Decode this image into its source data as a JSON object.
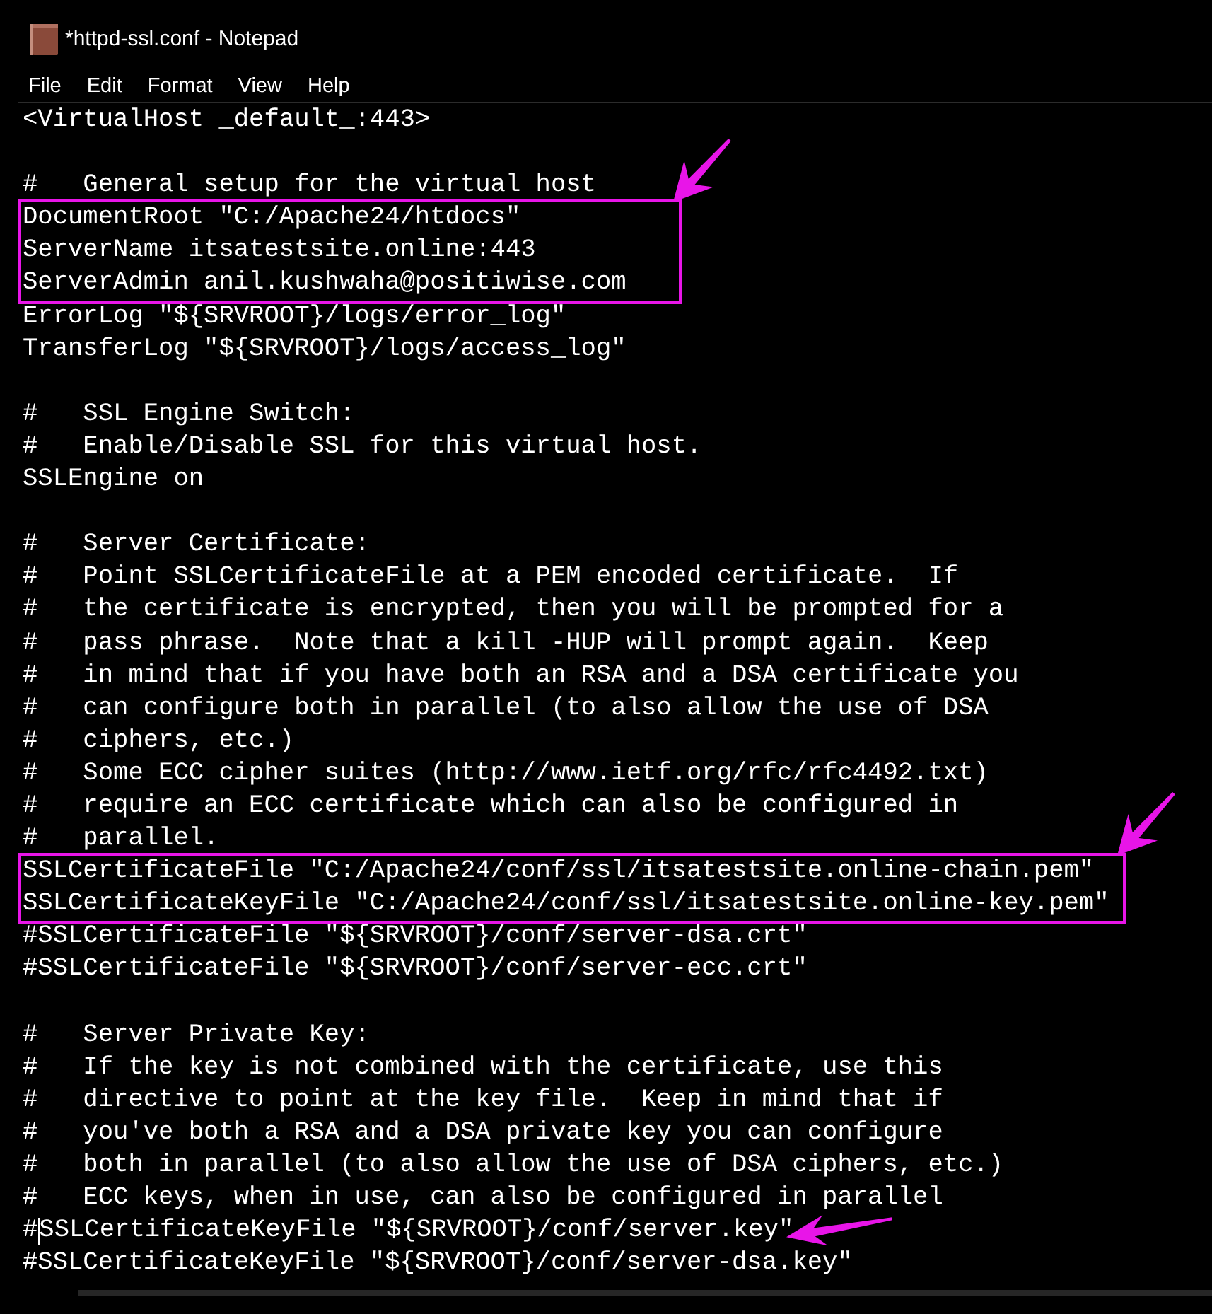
{
  "window": {
    "title": "*httpd-ssl.conf - Notepad"
  },
  "menu": [
    "File",
    "Edit",
    "Format",
    "View",
    "Help"
  ],
  "editor": {
    "blocks": [
      {
        "items": [
          {
            "kind": "line",
            "text": "<VirtualHost _default_:443>"
          }
        ]
      },
      {
        "items": [
          {
            "kind": "line",
            "text": "#   General setup for the virtual host"
          },
          {
            "kind": "boxed",
            "lines": [
              "DocumentRoot \"C:/Apache24/htdocs\"",
              "ServerName itsatestsite.online:443",
              "ServerAdmin anil.kushwaha@positiwise.com"
            ]
          },
          {
            "kind": "line",
            "text": "ErrorLog \"${SRVROOT}/logs/error_log\""
          },
          {
            "kind": "line",
            "text": "TransferLog \"${SRVROOT}/logs/access_log\""
          }
        ]
      },
      {
        "items": [
          {
            "kind": "line",
            "text": "#   SSL Engine Switch:"
          },
          {
            "kind": "line",
            "text": "#   Enable/Disable SSL for this virtual host."
          },
          {
            "kind": "line",
            "text": "SSLEngine on"
          }
        ]
      },
      {
        "items": [
          {
            "kind": "line",
            "text": "#   Server Certificate:"
          },
          {
            "kind": "line",
            "text": "#   Point SSLCertificateFile at a PEM encoded certificate.  If"
          },
          {
            "kind": "line",
            "text": "#   the certificate is encrypted, then you will be prompted for a"
          },
          {
            "kind": "line",
            "text": "#   pass phrase.  Note that a kill -HUP will prompt again.  Keep"
          },
          {
            "kind": "line",
            "text": "#   in mind that if you have both an RSA and a DSA certificate you"
          },
          {
            "kind": "line",
            "text": "#   can configure both in parallel (to also allow the use of DSA"
          },
          {
            "kind": "line",
            "text": "#   ciphers, etc.)"
          },
          {
            "kind": "line",
            "text": "#   Some ECC cipher suites (http://www.ietf.org/rfc/rfc4492.txt)"
          },
          {
            "kind": "line",
            "text": "#   require an ECC certificate which can also be configured in"
          },
          {
            "kind": "line",
            "text": "#   parallel."
          },
          {
            "kind": "boxed",
            "lines": [
              "SSLCertificateFile \"C:/Apache24/conf/ssl/itsatestsite.online-chain.pem\"",
              "SSLCertificateKeyFile \"C:/Apache24/conf/ssl/itsatestsite.online-key.pem\""
            ]
          },
          {
            "kind": "line",
            "text": "#SSLCertificateFile \"${SRVROOT}/conf/server-dsa.crt\""
          },
          {
            "kind": "line",
            "text": "#SSLCertificateFile \"${SRVROOT}/conf/server-ecc.crt\""
          }
        ]
      },
      {
        "items": [
          {
            "kind": "line",
            "text": "#   Server Private Key:"
          },
          {
            "kind": "line",
            "text": "#   If the key is not combined with the certificate, use this"
          },
          {
            "kind": "line",
            "text": "#   directive to point at the key file.  Keep in mind that if"
          },
          {
            "kind": "line",
            "text": "#   you've both a RSA and a DSA private key you can configure"
          },
          {
            "kind": "line",
            "text": "#   both in parallel (to also allow the use of DSA ciphers, etc.)"
          },
          {
            "kind": "line",
            "text": "#   ECC keys, when in use, can also be configured in parallel"
          },
          {
            "kind": "pointed",
            "text_before_caret": "#",
            "text_after_caret": "SSLCertificateKeyFile \"${SRVROOT}/conf/server.key\""
          },
          {
            "kind": "line",
            "text": "#SSLCertificateKeyFile \"${SRVROOT}/conf/server-dsa.key\""
          }
        ]
      }
    ]
  }
}
